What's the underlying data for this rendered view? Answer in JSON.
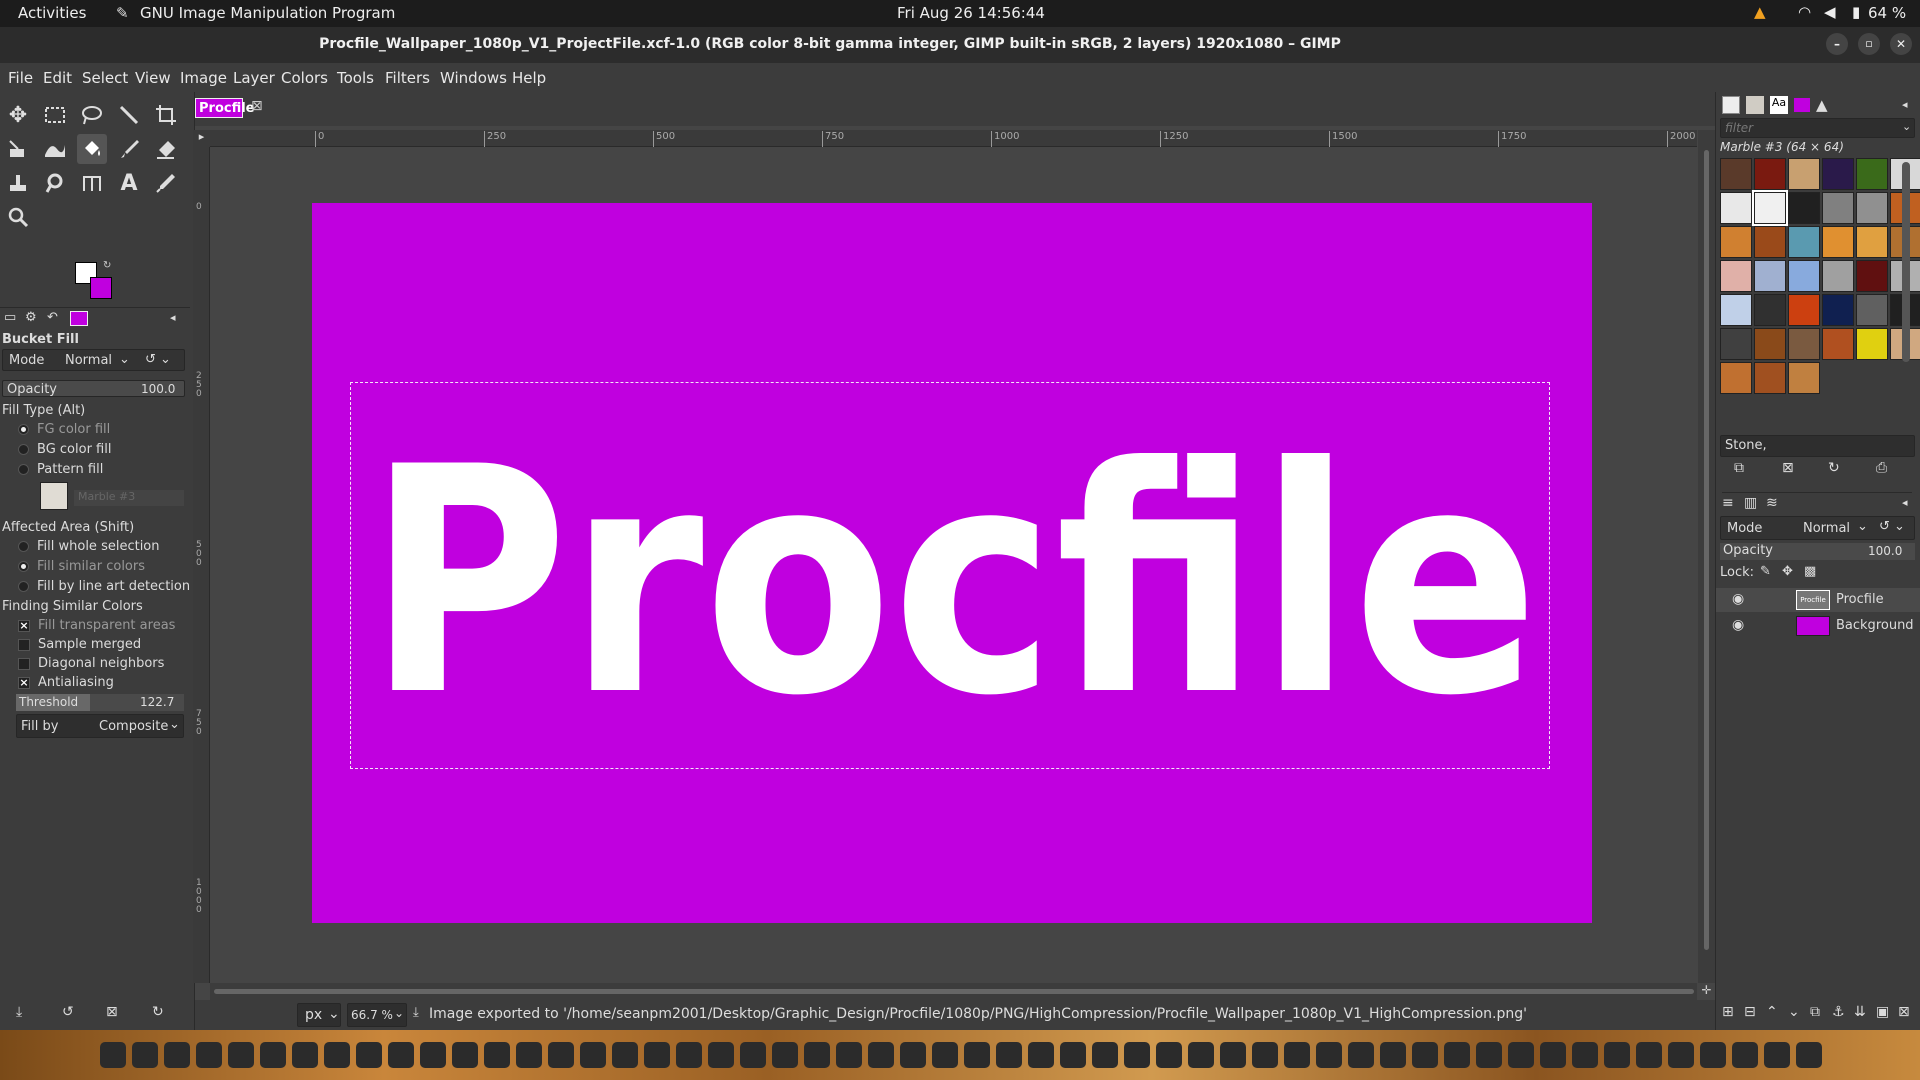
{
  "topbar": {
    "activities": "Activities",
    "app_name": "GNU Image Manipulation Program",
    "clock": "Fri Aug 26  14:56:44",
    "battery": "64 %"
  },
  "window": {
    "title": "Procfile_Wallpaper_1080p_V1_ProjectFile.xcf-1.0 (RGB color 8-bit gamma integer, GIMP built-in sRGB, 2 layers) 1920x1080 – GIMP"
  },
  "menu": {
    "items": [
      "File",
      "Edit",
      "Select",
      "View",
      "Image",
      "Layer",
      "Colors",
      "Tools",
      "Filters",
      "Windows",
      "Help"
    ]
  },
  "image_tab": {
    "label": "Procfile"
  },
  "canvas": {
    "text": "Procfile",
    "bg_color": "#c000df",
    "text_color": "#ffffff"
  },
  "ruler": {
    "h_ticks": [
      "0",
      "250",
      "500",
      "750",
      "1000",
      "1250",
      "1500",
      "1750",
      "2000"
    ],
    "v_ticks": [
      "0",
      "2\n5\n0",
      "5\n0\n0",
      "7\n5\n0",
      "1\n0\n0\n0"
    ]
  },
  "colors": {
    "fg": "#ffffff",
    "bg": "#c000df"
  },
  "tool_options": {
    "title": "Bucket Fill",
    "mode_label": "Mode",
    "mode_value": "Normal",
    "opacity_label": "Opacity",
    "opacity_value": "100.0",
    "fill_type_label": "Fill Type  (Alt)",
    "fill_types": [
      "FG color fill",
      "BG color fill",
      "Pattern fill"
    ],
    "pattern_name": "Marble #3",
    "affected_label": "Affected Area  (Shift)",
    "affected": [
      "Fill whole selection",
      "Fill similar colors",
      "Fill by line art detection"
    ],
    "similar_label": "Finding Similar Colors",
    "checks": [
      "Fill transparent areas",
      "Sample merged",
      "Diagonal neighbors",
      "Antialiasing"
    ],
    "threshold_label": "Threshold",
    "threshold_value": "122.7",
    "fillby_label": "Fill by",
    "fillby_value": "Composite"
  },
  "status": {
    "unit": "px",
    "zoom": "66.7 %",
    "message": "Image exported to '/home/seanpm2001/Desktop/Graphic_Design/Procfile/1080p/PNG/HighCompression/Procfile_Wallpaper_1080p_V1_HighCompression.png'"
  },
  "patterns": {
    "filter_placeholder": "filter",
    "selected_name": "Marble #3 (64 × 64)",
    "tag": "Stone,",
    "swatches": [
      "#5a3a2a",
      "#7a1a10",
      "#c8a070",
      "#2a1a4a",
      "#3a6a1a",
      "#d8d8d8",
      "#e8e8e8",
      "#f0f0f0",
      "#202020",
      "#808080",
      "#909090",
      "#c06020",
      "#d08030",
      "#9a4a1a",
      "#5a9ab0",
      "#e09030",
      "#e0a040",
      "#b07030",
      "#e0b0a8",
      "#a0b0d0",
      "#88aadd",
      "#a0a0a0",
      "#601010",
      "#b0b0b0",
      "#c0d0e8",
      "#303030",
      "#cc4010",
      "#102050",
      "#606060",
      "#202020",
      "#404040",
      "#8a4a1a",
      "#7a5a40",
      "#b05020",
      "#e0d010",
      "#d0a880",
      "#c07030",
      "#a05020",
      "#c08040"
    ]
  },
  "layers": {
    "mode_label": "Mode",
    "mode_value": "Normal",
    "opacity_label": "Opacity",
    "opacity_value": "100.0",
    "lock_label": "Lock:",
    "items": [
      {
        "name": "Procfile"
      },
      {
        "name": "Background"
      }
    ]
  }
}
